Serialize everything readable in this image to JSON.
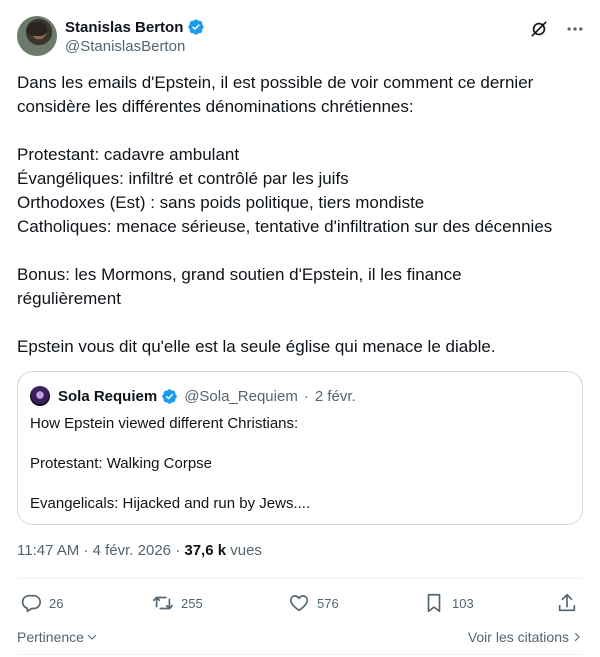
{
  "author": {
    "display_name": "Stanislas Berton",
    "handle": "@StanislasBerton",
    "verified": true
  },
  "tweet_lines": [
    "Dans les emails d'Epstein, il est possible de voir comment ce dernier",
    "considère les différentes dénominations chrétiennes:",
    "",
    "Protestant: cadavre ambulant",
    "Évangéliques: infiltré et contrôlé par les juifs",
    "Orthodoxes (Est) : sans poids politique, tiers mondiste",
    "Catholiques: menace sérieuse, tentative d'infiltration sur des décennies",
    "",
    "Bonus: les Mormons, grand soutien d'Epstein, il les finance",
    "régulièrement",
    "",
    "Epstein vous dit qu'elle est la seule église qui menace le diable."
  ],
  "quote": {
    "display_name": "Sola Requiem",
    "handle": "@Sola_Requiem",
    "separator": "·",
    "date": "2 févr.",
    "lines": [
      "How Epstein viewed different Christians:",
      "",
      "Protestant: Walking Corpse",
      "",
      "Evangelicals: Hijacked and run by Jews...."
    ]
  },
  "meta": {
    "time": "11:47 AM",
    "separator": "·",
    "date": "4 févr. 2026",
    "views_count": "37,6 k",
    "views_label": "vues"
  },
  "actions": {
    "replies": "26",
    "reposts": "255",
    "likes": "576",
    "bookmarks": "103"
  },
  "footer": {
    "relevance_label": "Pertinence",
    "quotes_label": "Voir les citations"
  },
  "colors": {
    "text": "#0f1419",
    "secondary": "#536471",
    "verified": "#1d9bf0",
    "border": "#cfd9de"
  }
}
